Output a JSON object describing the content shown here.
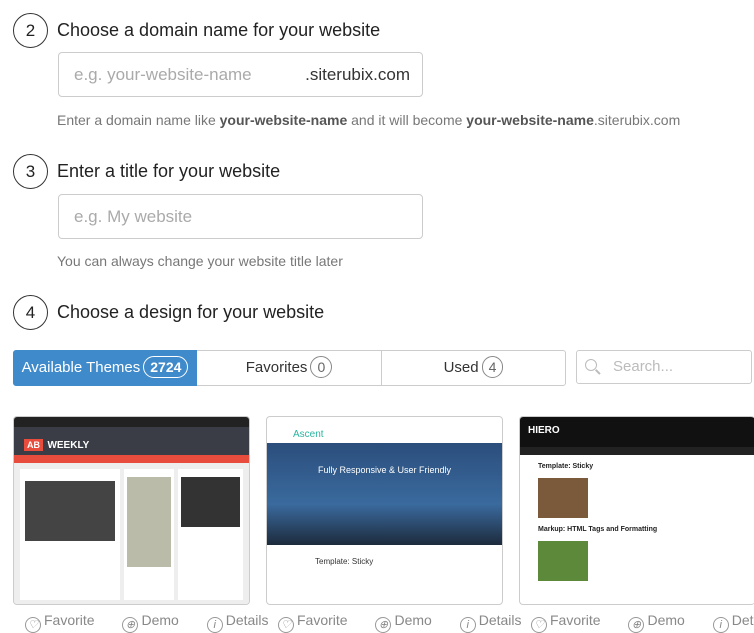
{
  "steps": [
    {
      "num": "2",
      "title": "Choose a domain name for your website",
      "placeholder": "e.g. your-website-name",
      "suffix": ".siterubix.com",
      "help": {
        "pre": "Enter a domain name like ",
        "b1": "your-website-name",
        "mid": " and it will become ",
        "b2": "your-website-name",
        "post": ".siterubix.com"
      }
    },
    {
      "num": "3",
      "title": "Enter a title for your website",
      "placeholder": "e.g. My website",
      "help": "You can always change your website title later"
    },
    {
      "num": "4",
      "title": "Choose a design for your website"
    }
  ],
  "tabs": [
    {
      "label": "Available Themes",
      "count": "2724"
    },
    {
      "label": "Favorites",
      "count": "0"
    },
    {
      "label": "Used",
      "count": "4"
    }
  ],
  "search_placeholder": "Search...",
  "accent": "#3f8acb",
  "themes": [
    {
      "name": "AB Weekly",
      "logo": "WEEKLY"
    },
    {
      "name": "Ascent",
      "logo": "Ascent",
      "hero": "Fully Responsive & User Friendly",
      "post": "Template: Sticky"
    },
    {
      "name": "Hiero",
      "logo": "HIERO",
      "post": "Template: Sticky",
      "post2": "Markup: HTML Tags and Formatting"
    }
  ],
  "actions": {
    "favorite": "Favorite",
    "demo": "Demo",
    "details": "Details"
  }
}
